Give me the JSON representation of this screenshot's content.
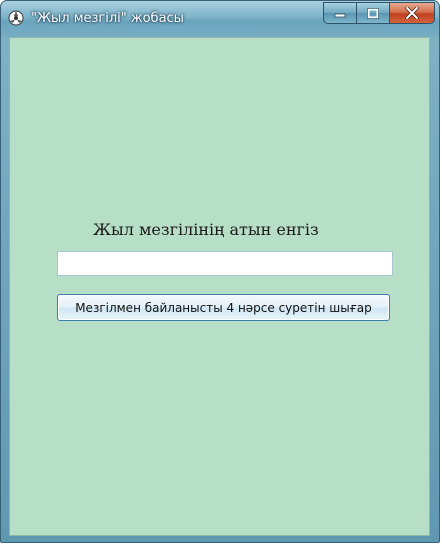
{
  "window": {
    "title": "\"Жыл мезгілі\" жобасы",
    "app_icon": "app-icon",
    "controls": {
      "minimize_icon": "minimize-icon",
      "maximize_icon": "maximize-icon",
      "close_icon": "close-icon",
      "close_color": "#c94a26"
    }
  },
  "form": {
    "prompt_label": "Жыл мезгілінің атын енгіз",
    "season_input": {
      "value": "",
      "placeholder": ""
    },
    "show_button_label": "Мезгілмен байланысты 4 нәрсе суретін шығар"
  },
  "colors": {
    "client_background": "#b7dec6",
    "titlebar": "#7db3c9"
  }
}
